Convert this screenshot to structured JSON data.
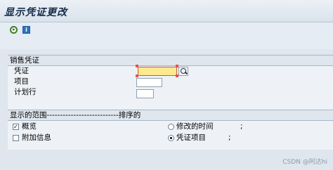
{
  "window": {
    "title": "显示凭证更改"
  },
  "toolbar": {
    "execute_icon": "execute-icon",
    "info_icon": "info-icon",
    "info_glyph": "i"
  },
  "sales_doc_group": {
    "title": "销售凭证",
    "fields": [
      {
        "label": "凭证",
        "value": ""
      },
      {
        "label": "项目",
        "value": ""
      },
      {
        "label": "计划行",
        "value": ""
      }
    ]
  },
  "display_group": {
    "title": "显示的范围---------------------------排序的",
    "options": [
      {
        "label": "概览",
        "checked": true,
        "check_glyph": "✓"
      },
      {
        "label": "附加信息",
        "checked": false
      }
    ],
    "sort": [
      {
        "label": "修改的时间",
        "selected": false,
        "suffix": ";"
      },
      {
        "label": "凭证项目",
        "selected": true,
        "suffix": ";"
      }
    ]
  },
  "watermark": "CSDN @阿达hi"
}
